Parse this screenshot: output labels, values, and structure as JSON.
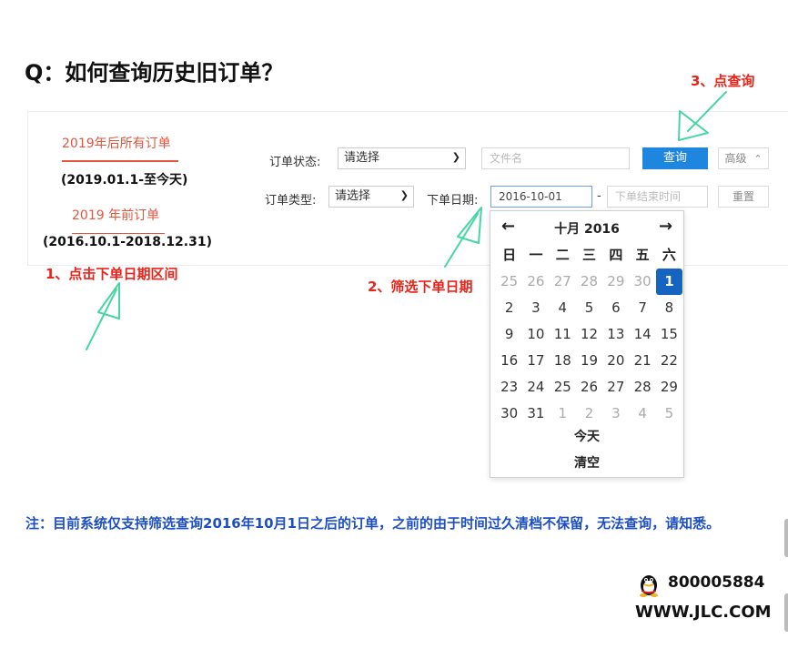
{
  "title": "Q：如何查询历史旧订单？",
  "sidebar": {
    "link_2019_after": "2019年后所有订单",
    "range_2019_after": "(2019.01.1-至今天)",
    "link_2019_before": "2019 年前订单",
    "range_2019_before": "(2016.10.1-2018.12.31)"
  },
  "filters": {
    "status_label": "订单状态:",
    "status_value": "请选择",
    "filename_placeholder": "文件名",
    "query_label": "查询",
    "advanced_label": "高级",
    "type_label": "订单类型:",
    "type_value": "请选择",
    "date_label": "下单日期:",
    "date_start": "2016-10-01",
    "date_sep": "-",
    "date_end_placeholder": "下单结束时间",
    "reset_label": "重置"
  },
  "annotations": {
    "step1": "1、点击下单日期区间",
    "step2": "2、筛选下单日期",
    "step3": "3、点查询"
  },
  "calendar": {
    "prev": "←",
    "next": "→",
    "month_title": "十月 2016",
    "weekdays": [
      "日",
      "一",
      "二",
      "三",
      "四",
      "五",
      "六"
    ],
    "days": [
      {
        "d": "25",
        "m": true
      },
      {
        "d": "26",
        "m": true
      },
      {
        "d": "27",
        "m": true
      },
      {
        "d": "28",
        "m": true
      },
      {
        "d": "29",
        "m": true
      },
      {
        "d": "30",
        "m": true
      },
      {
        "d": "1",
        "s": true
      },
      {
        "d": "2"
      },
      {
        "d": "3"
      },
      {
        "d": "4"
      },
      {
        "d": "5"
      },
      {
        "d": "6"
      },
      {
        "d": "7"
      },
      {
        "d": "8"
      },
      {
        "d": "9"
      },
      {
        "d": "10"
      },
      {
        "d": "11"
      },
      {
        "d": "12"
      },
      {
        "d": "13"
      },
      {
        "d": "14"
      },
      {
        "d": "15"
      },
      {
        "d": "16"
      },
      {
        "d": "17"
      },
      {
        "d": "18"
      },
      {
        "d": "19"
      },
      {
        "d": "20"
      },
      {
        "d": "21"
      },
      {
        "d": "22"
      },
      {
        "d": "23"
      },
      {
        "d": "24"
      },
      {
        "d": "25"
      },
      {
        "d": "26"
      },
      {
        "d": "27"
      },
      {
        "d": "28"
      },
      {
        "d": "29"
      },
      {
        "d": "30"
      },
      {
        "d": "31"
      },
      {
        "d": "1",
        "m": true
      },
      {
        "d": "2",
        "m": true
      },
      {
        "d": "3",
        "m": true
      },
      {
        "d": "4",
        "m": true
      },
      {
        "d": "5",
        "m": true
      }
    ],
    "today_label": "今天",
    "clear_label": "清空"
  },
  "note": "注：目前系统仅支持筛选查询2016年10月1日之后的订单，之前的由于时间过久清档不保留，无法查询，请知悉。",
  "footer": {
    "phone": "800005884",
    "website": "WWW.JLC.COM"
  },
  "colors": {
    "accent_red": "#e8241a",
    "link_red": "#e4553f",
    "query_blue": "#1f86e0",
    "selected_day": "#1565c0",
    "note_blue": "#1d4fc4",
    "arrow_green": "#45d6a2"
  }
}
